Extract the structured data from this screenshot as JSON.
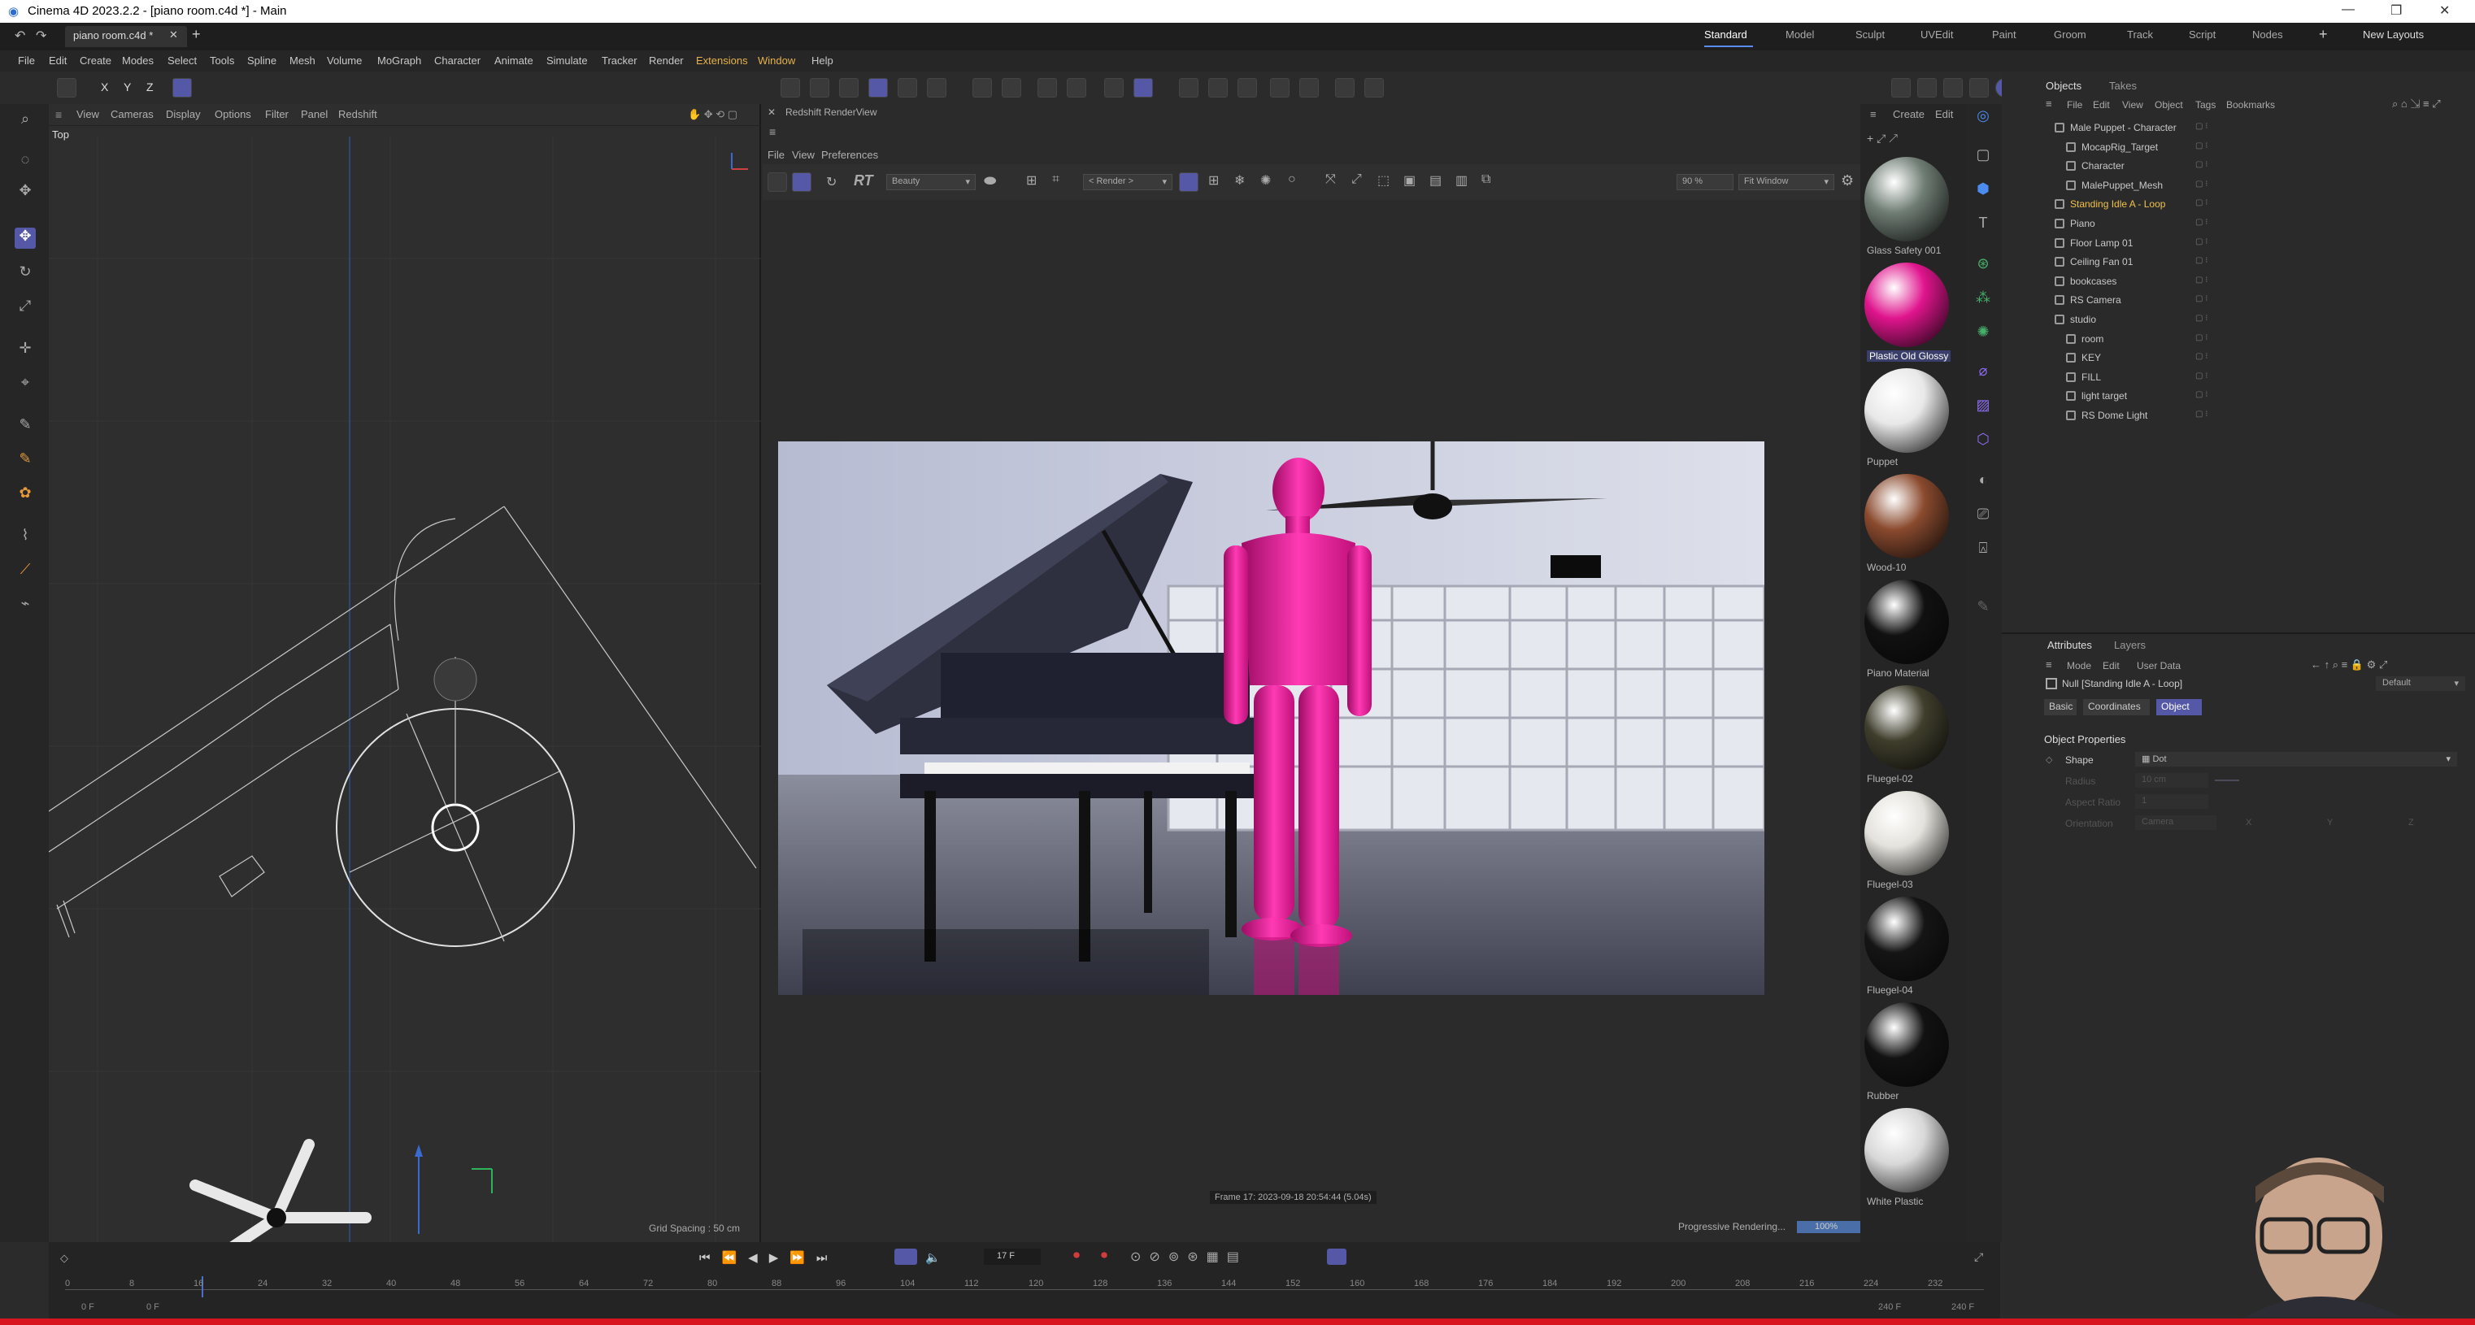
{
  "window": {
    "title": "Cinema 4D 2023.2.2 - [piano room.c4d *] - Main"
  },
  "doc_tab": "piano room.c4d *",
  "menu": [
    "File",
    "Edit",
    "Create",
    "Modes",
    "Select",
    "Tools",
    "Spline",
    "Mesh",
    "Volume",
    "MoGraph",
    "Character",
    "Animate",
    "Simulate",
    "Tracker",
    "Render",
    "Extensions",
    "Window",
    "Help"
  ],
  "layouts": [
    "Standard",
    "Model",
    "Sculpt",
    "UVEdit",
    "Paint",
    "Groom",
    "Track",
    "Script",
    "Nodes"
  ],
  "new_layouts": "New Layouts",
  "axis_labels": [
    "X",
    "Y",
    "Z"
  ],
  "viewport": {
    "menu": [
      "View",
      "Cameras",
      "Display",
      "Options",
      "Filter",
      "Panel",
      "Redshift"
    ],
    "view_name": "Top",
    "grid_spacing": "Grid Spacing : 50 cm"
  },
  "renderview": {
    "title": "Redshift RenderView",
    "menu": [
      "File",
      "View",
      "Preferences"
    ],
    "rt_label": "RT",
    "aov": "Beauty",
    "render_select": "< Render >",
    "zoom": "90 %",
    "fit": "Fit Window",
    "frame_info": "Frame 17:  2023-09-18  20:54:44  (5.04s)",
    "progress_label": "Progressive Rendering...",
    "progress_value": "100%",
    "progress_fraction": 1.0
  },
  "materials_panel": {
    "menu": [
      "Create",
      "Edit"
    ]
  },
  "materials": [
    {
      "name": "Glass Safety 001",
      "color": "#6f7d74"
    },
    {
      "name": "Plastic Old Glossy",
      "color": "#e0148d"
    },
    {
      "name": "Puppet",
      "color": "#e8e8e8"
    },
    {
      "name": "Wood-10",
      "color": "#8a4a2e"
    },
    {
      "name": "Piano Material",
      "color": "#111111"
    },
    {
      "name": "Fluegel-02",
      "color": "#3f3e2c"
    },
    {
      "name": "Fluegel-03",
      "color": "#e3e2dc"
    },
    {
      "name": "Fluegel-04",
      "color": "#151515"
    },
    {
      "name": "Rubber",
      "color": "#121212"
    },
    {
      "name": "White Plastic",
      "color": "#d8d8d8"
    }
  ],
  "objects_panel": {
    "tabs": [
      "Objects",
      "Takes"
    ],
    "menu": [
      "File",
      "Edit",
      "View",
      "Object",
      "Tags",
      "Bookmarks"
    ],
    "items": [
      {
        "name": "Male Puppet - Character"
      },
      {
        "name": "MocapRig_Target"
      },
      {
        "name": "Character"
      },
      {
        "name": "MalePuppet_Mesh"
      },
      {
        "name": "Standing Idle A - Loop"
      },
      {
        "name": "Piano"
      },
      {
        "name": "Floor Lamp 01"
      },
      {
        "name": "Ceiling Fan 01"
      },
      {
        "name": "bookcases"
      },
      {
        "name": "RS Camera"
      },
      {
        "name": "studio"
      },
      {
        "name": "room"
      },
      {
        "name": "KEY"
      },
      {
        "name": "FILL"
      },
      {
        "name": "light target"
      },
      {
        "name": "RS Dome Light"
      }
    ]
  },
  "attributes": {
    "tabs": [
      "Attributes",
      "Layers"
    ],
    "menu": [
      "Mode",
      "Edit",
      "User Data"
    ],
    "preset": "Default",
    "object_title": "Null [Standing Idle A - Loop]",
    "subtabs": [
      "Basic",
      "Coordinates",
      "Object"
    ],
    "section": "Object Properties",
    "shape_label": "Shape",
    "shape_value": "Dot",
    "radius_label": "Radius",
    "radius_value": "10 cm",
    "aspect_label": "Aspect Ratio",
    "aspect_value": "1",
    "orientation_label": "Orientation",
    "orientation_value": "Camera",
    "orient_axes": [
      "X",
      "Y",
      "Z"
    ]
  },
  "timeline": {
    "ticks": [
      "0",
      "8",
      "16",
      "24",
      "32",
      "40",
      "48",
      "56",
      "64",
      "72",
      "80",
      "88",
      "96",
      "104",
      "112",
      "120",
      "128",
      "136",
      "144",
      "152",
      "160",
      "168",
      "176",
      "184",
      "192",
      "200",
      "208",
      "216",
      "224",
      "232"
    ],
    "start": "0 F",
    "start2": "0 F",
    "current_frame": "17 F",
    "end": "240 F",
    "end2": "240 F"
  },
  "colors": {
    "accent": "#5558a6",
    "selected_object": "#f0c24c",
    "magenta": "#e0148d"
  }
}
